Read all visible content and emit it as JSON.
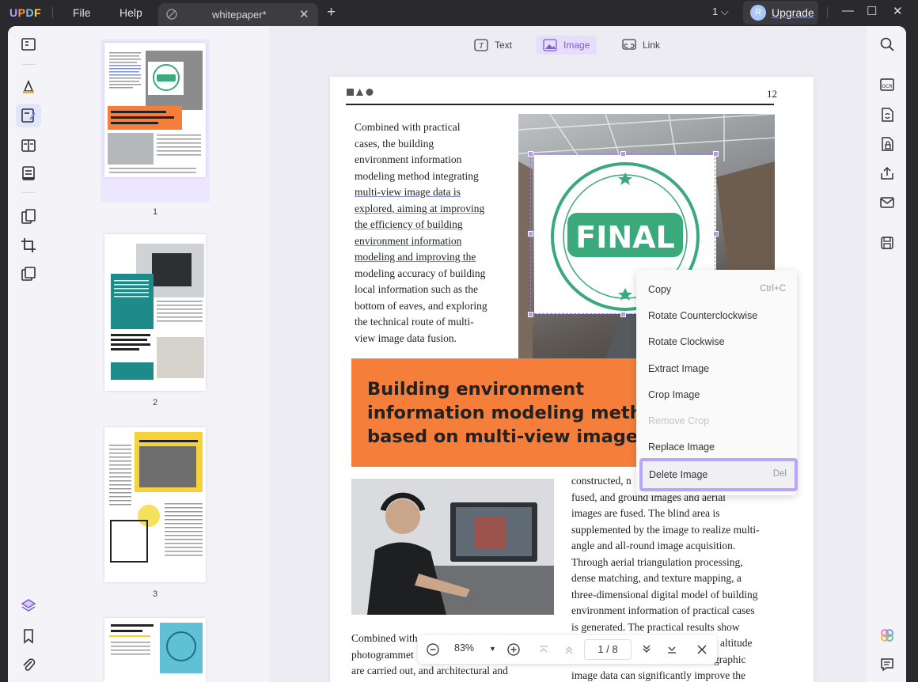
{
  "titlebar": {
    "menu": [
      "File",
      "Help"
    ],
    "tab_label": "whitepaper*",
    "page_selector": "1",
    "upgrade_label": "Upgrade",
    "avatar_initial": "R"
  },
  "left_tools": [
    "reader-icon",
    "comment-icon",
    "edit-icon",
    "organize-icon",
    "form-icon",
    "page-tools-icon",
    "crop-icon",
    "batch-icon",
    "layers-icon",
    "bookmark-icon",
    "attachment-icon"
  ],
  "thumbnails": [
    {
      "number": "1",
      "heading": "Building environment information modeling method based on multi-view image",
      "stamp": "FINAL"
    },
    {
      "number": "2",
      "heading": "Preservation and inheritance of architectural multi-dimensional data"
    },
    {
      "number": "3",
      "heading": "Geometric Philosophy"
    },
    {
      "number": "4",
      "heading": "Basic Elements of Plane Space"
    }
  ],
  "edit_toolbar": {
    "text_label": "Text",
    "image_label": "Image",
    "link_label": "Link"
  },
  "page": {
    "page_number": "12",
    "col1_lines": [
      "Combined with practical",
      "cases, the building",
      "environment information",
      "modeling method integrating",
      "multi-view image data is",
      "explored, aiming at improving",
      "the efficiency of building",
      "environment information",
      "modeling and improving the",
      "modeling accuracy of building",
      "local information such as the",
      "bottom of eaves, and exploring",
      "the technical route of multi-",
      "view image data fusion."
    ],
    "stamp_text": "FINAL",
    "banner_lines": [
      "Building environment",
      "information modeling metho",
      "based on multi-view image"
    ],
    "col2_lines": [
      "constructed, n",
      "fused, and ground images and aerial",
      "images are fused. The blind area is",
      "supplemented by the image to realize multi-",
      "angle and all-round image acquisition.",
      "Through aerial triangulation processing,",
      "dense matching, and texture mapping, a",
      "three-dimensional digital model of building",
      "environment information of practical cases",
      "is generated. The practical results show",
      "altitude",
      "graphic",
      "image data can significantly improve the"
    ],
    "bottom_left_lines": [
      "Combined with",
      "photogrammet",
      "are carried out, and architectural and"
    ]
  },
  "context_menu": [
    {
      "label": "Copy",
      "shortcut": "Ctrl+C",
      "disabled": false
    },
    {
      "label": "Rotate Counterclockwise",
      "shortcut": "",
      "disabled": false
    },
    {
      "label": "Rotate Clockwise",
      "shortcut": "",
      "disabled": false
    },
    {
      "label": "Extract Image",
      "shortcut": "",
      "disabled": false
    },
    {
      "label": "Crop Image",
      "shortcut": "",
      "disabled": false
    },
    {
      "label": "Remove Crop",
      "shortcut": "",
      "disabled": true
    },
    {
      "label": "Replace Image",
      "shortcut": "",
      "disabled": false
    },
    {
      "label": "Delete Image",
      "shortcut": "Del",
      "disabled": false,
      "highlighted": true
    }
  ],
  "bottom_bar": {
    "zoom": "83%",
    "current_page": "1",
    "page_separator": "/",
    "total_pages": "8"
  },
  "right_tools": [
    "search-icon",
    "ocr-icon",
    "convert-icon",
    "protect-icon",
    "share-icon",
    "email-icon",
    "save-icon",
    "ai-assistant-icon",
    "comment-panel-icon"
  ],
  "colors": {
    "accent": "#7b5bd6",
    "banner": "#f57f3a",
    "stamp": "#3aa97b",
    "highlight_border": "#b9a5ff"
  }
}
